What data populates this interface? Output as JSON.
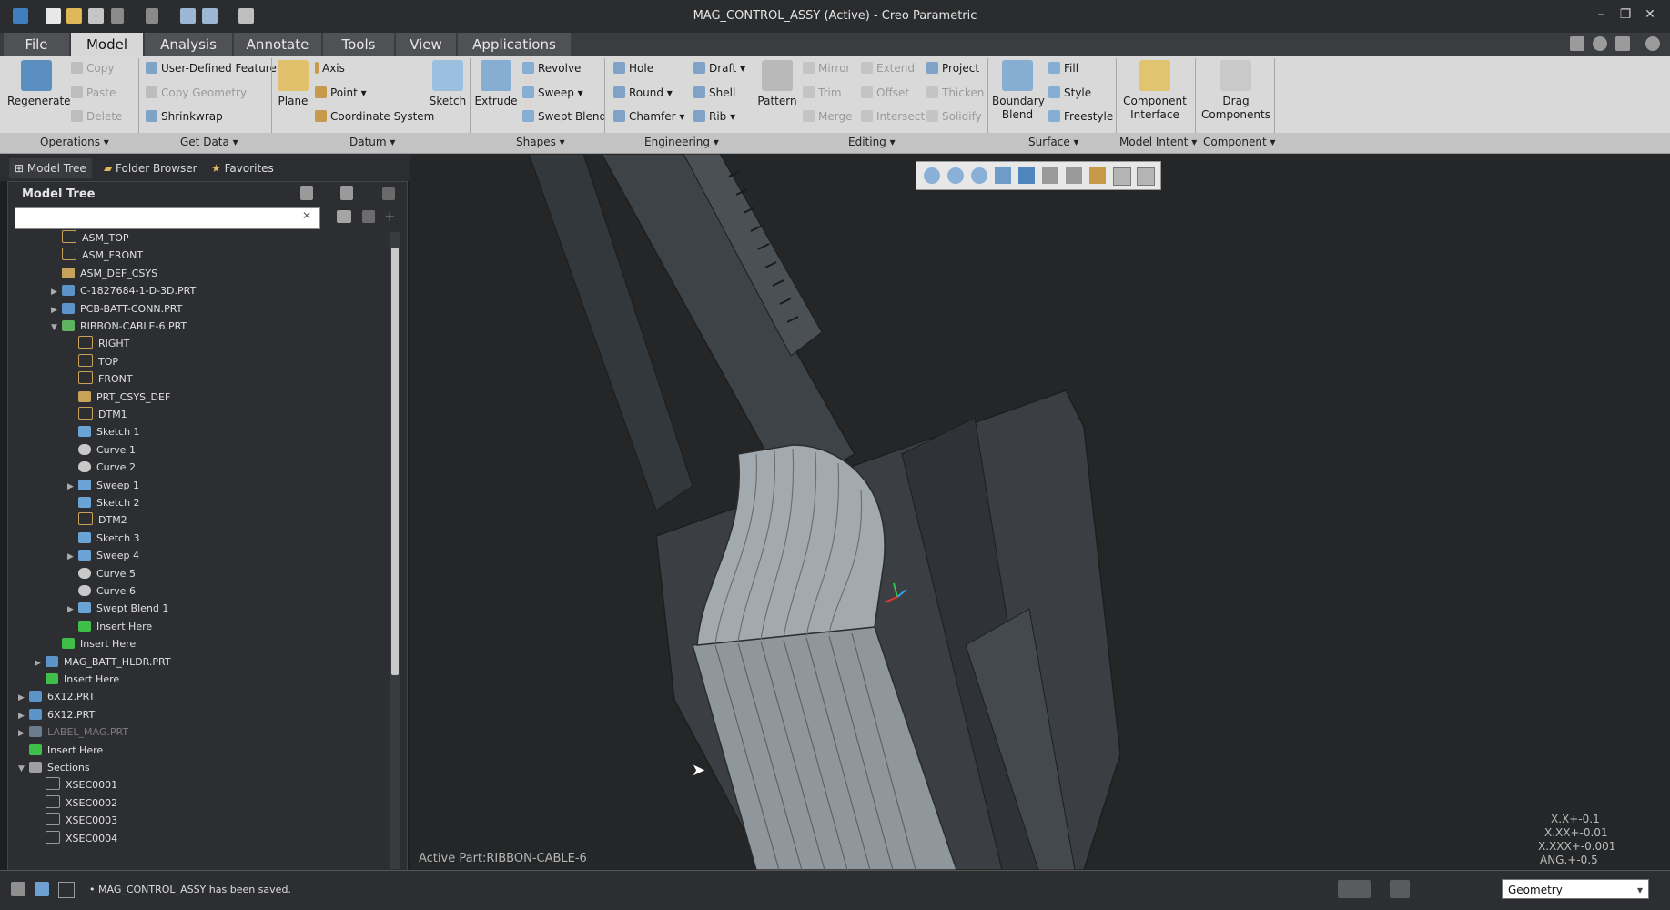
{
  "window": {
    "title": "MAG_CONTROL_ASSY (Active) - Creo Parametric",
    "controls": [
      "minimize",
      "restore",
      "close"
    ]
  },
  "tabs": [
    "File",
    "Model",
    "Analysis",
    "Annotate",
    "Tools",
    "View",
    "Applications"
  ],
  "active_tab": "Model",
  "ribbon": {
    "operations": {
      "label": "Operations",
      "regenerate": "Regenerate",
      "copy": "Copy",
      "paste": "Paste",
      "delete": "Delete"
    },
    "getdata": {
      "label": "Get Data",
      "udf": "User-Defined Feature",
      "copy_geometry": "Copy Geometry",
      "shrinkwrap": "Shrinkwrap"
    },
    "datum": {
      "label": "Datum",
      "plane": "Plane",
      "axis": "Axis",
      "point": "Point",
      "csys": "Coordinate System",
      "sketch": "Sketch"
    },
    "shapes": {
      "label": "Shapes",
      "extrude": "Extrude",
      "revolve": "Revolve",
      "sweep": "Sweep",
      "swept_blend": "Swept Blend"
    },
    "engineering": {
      "label": "Engineering",
      "hole": "Hole",
      "round": "Round",
      "chamfer": "Chamfer",
      "draft": "Draft",
      "shell": "Shell",
      "rib": "Rib"
    },
    "editing": {
      "label": "Editing",
      "pattern": "Pattern",
      "mirror": "Mirror",
      "trim": "Trim",
      "merge": "Merge",
      "extend": "Extend",
      "offset": "Offset",
      "intersect": "Intersect",
      "project": "Project",
      "thicken": "Thicken",
      "solidify": "Solidify"
    },
    "surface": {
      "label": "Surface",
      "boundary_blend_1": "Boundary",
      "boundary_blend_2": "Blend",
      "fill": "Fill",
      "style": "Style",
      "freestyle": "Freestyle"
    },
    "model_intent": {
      "label": "Model Intent",
      "ci_1": "Component",
      "ci_2": "Interface"
    },
    "component": {
      "label": "Component",
      "drag_1": "Drag",
      "drag_2": "Components"
    }
  },
  "left_tabs": [
    "Model Tree",
    "Folder Browser",
    "Favorites"
  ],
  "model_tree": {
    "title": "Model Tree",
    "search_value": "",
    "items": [
      {
        "label": "ASM_TOP",
        "indent": 2,
        "icon": "datum-plane",
        "expander": ""
      },
      {
        "label": "ASM_FRONT",
        "indent": 2,
        "icon": "datum-plane",
        "expander": ""
      },
      {
        "label": "ASM_DEF_CSYS",
        "indent": 2,
        "icon": "csys",
        "expander": ""
      },
      {
        "label": "C-1827684-1-D-3D.PRT",
        "indent": 2,
        "icon": "part",
        "expander": "▶"
      },
      {
        "label": "PCB-BATT-CONN.PRT",
        "indent": 2,
        "icon": "part",
        "expander": "▶"
      },
      {
        "label": "RIBBON-CABLE-6.PRT",
        "indent": 2,
        "icon": "part-active",
        "expander": "▼"
      },
      {
        "label": "RIGHT",
        "indent": 3,
        "icon": "datum-plane",
        "expander": ""
      },
      {
        "label": "TOP",
        "indent": 3,
        "icon": "datum-plane",
        "expander": ""
      },
      {
        "label": "FRONT",
        "indent": 3,
        "icon": "datum-plane",
        "expander": ""
      },
      {
        "label": "PRT_CSYS_DEF",
        "indent": 3,
        "icon": "csys",
        "expander": ""
      },
      {
        "label": "DTM1",
        "indent": 3,
        "icon": "datum-plane",
        "expander": ""
      },
      {
        "label": "Sketch 1",
        "indent": 3,
        "icon": "sketch",
        "expander": ""
      },
      {
        "label": "Curve 1",
        "indent": 3,
        "icon": "curve",
        "expander": ""
      },
      {
        "label": "Curve 2",
        "indent": 3,
        "icon": "curve",
        "expander": ""
      },
      {
        "label": "Sweep 1",
        "indent": 3,
        "icon": "sweep",
        "expander": "▶"
      },
      {
        "label": "Sketch 2",
        "indent": 3,
        "icon": "sketch",
        "expander": ""
      },
      {
        "label": "DTM2",
        "indent": 3,
        "icon": "datum-plane",
        "expander": ""
      },
      {
        "label": "Sketch 3",
        "indent": 3,
        "icon": "sketch",
        "expander": ""
      },
      {
        "label": "Sweep 4",
        "indent": 3,
        "icon": "sweep",
        "expander": "▶"
      },
      {
        "label": "Curve 5",
        "indent": 3,
        "icon": "curve",
        "expander": ""
      },
      {
        "label": "Curve 6",
        "indent": 3,
        "icon": "curve",
        "expander": ""
      },
      {
        "label": "Swept Blend 1",
        "indent": 3,
        "icon": "sweep",
        "expander": "▶"
      },
      {
        "label": "Insert Here",
        "indent": 3,
        "icon": "insert",
        "expander": ""
      },
      {
        "label": "Insert Here",
        "indent": 2,
        "icon": "insert",
        "expander": ""
      },
      {
        "label": "MAG_BATT_HLDR.PRT",
        "indent": 1,
        "icon": "part",
        "expander": "▶"
      },
      {
        "label": "Insert Here",
        "indent": 1,
        "icon": "insert",
        "expander": ""
      },
      {
        "label": "6X12.PRT",
        "indent": 0,
        "icon": "part",
        "expander": "▶"
      },
      {
        "label": "6X12.PRT",
        "indent": 0,
        "icon": "part",
        "expander": "▶"
      },
      {
        "label": "LABEL_MAG.PRT",
        "indent": 0,
        "icon": "part-dim",
        "expander": "▶"
      },
      {
        "label": "Insert Here",
        "indent": 0,
        "icon": "insert",
        "expander": ""
      },
      {
        "label": "Sections",
        "indent": 0,
        "icon": "folder",
        "expander": "▼"
      },
      {
        "label": "XSEC0001",
        "indent": 1,
        "icon": "section",
        "expander": ""
      },
      {
        "label": "XSEC0002",
        "indent": 1,
        "icon": "section",
        "expander": ""
      },
      {
        "label": "XSEC0003",
        "indent": 1,
        "icon": "section",
        "expander": ""
      },
      {
        "label": "XSEC0004",
        "indent": 1,
        "icon": "section",
        "expander": ""
      }
    ]
  },
  "viewport": {
    "active_part": "Active Part:RIBBON-CABLE-6",
    "tolerances": [
      "X.X+-0.1",
      "X.XX+-0.01",
      "X.XXX+-0.001",
      "ANG.+-0.5"
    ]
  },
  "status": {
    "message": "MAG_CONTROL_ASSY has been saved.",
    "filter_value": "Geometry"
  },
  "colors": {
    "background": "#1e1f21",
    "ribbon": "#d9d9d9",
    "model_surface": "#8f969c"
  }
}
